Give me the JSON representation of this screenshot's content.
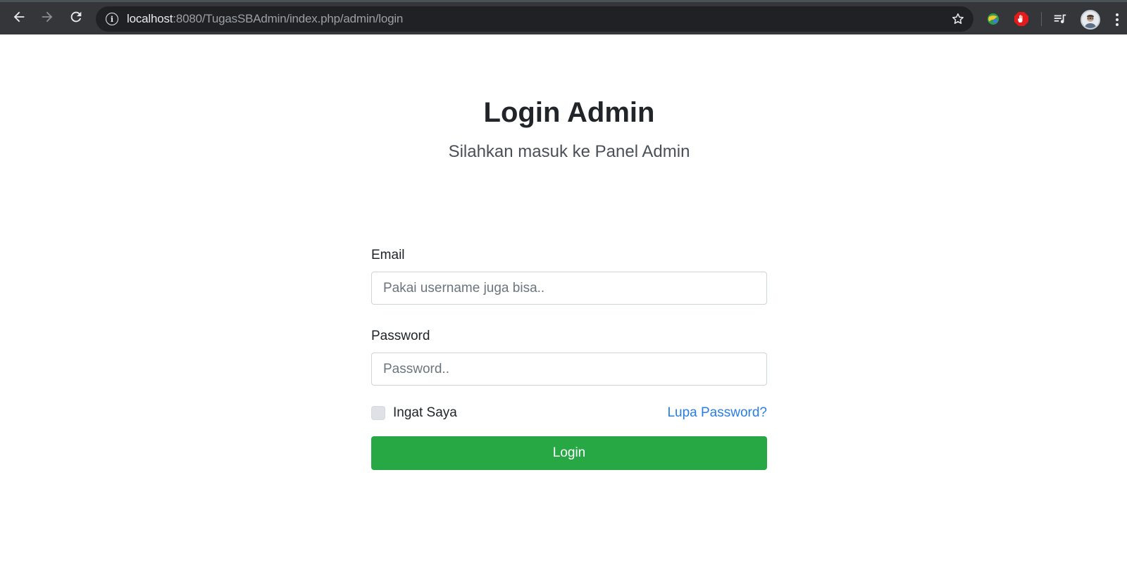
{
  "browser": {
    "url_host": "localhost",
    "url_rest": ":8080/TugasSBAdmin/index.php/admin/login",
    "icons": {
      "back": "back-arrow-icon",
      "forward": "forward-arrow-icon",
      "reload": "reload-icon",
      "info": "site-info-icon",
      "bookmark": "star-icon",
      "extension_1": "globe-extension-icon",
      "extension_2": "adblock-hand-icon",
      "media": "media-queue-icon",
      "profile": "profile-avatar",
      "menu": "kebab-menu-icon"
    },
    "info_glyph": "i"
  },
  "page": {
    "title": "Login Admin",
    "subtitle": "Silahkan masuk ke Panel Admin"
  },
  "form": {
    "email_label": "Email",
    "email_placeholder": "Pakai username juga bisa..",
    "email_value": "",
    "password_label": "Password",
    "password_placeholder": "Password..",
    "password_value": "",
    "remember_label": "Ingat Saya",
    "remember_checked": false,
    "forgot_link": "Lupa Password?",
    "submit_label": "Login"
  },
  "colors": {
    "chrome_bg": "#35363a",
    "omnibox_bg": "#202124",
    "submit_bg": "#28a745",
    "link": "#2a7de1",
    "title": "#212529"
  }
}
